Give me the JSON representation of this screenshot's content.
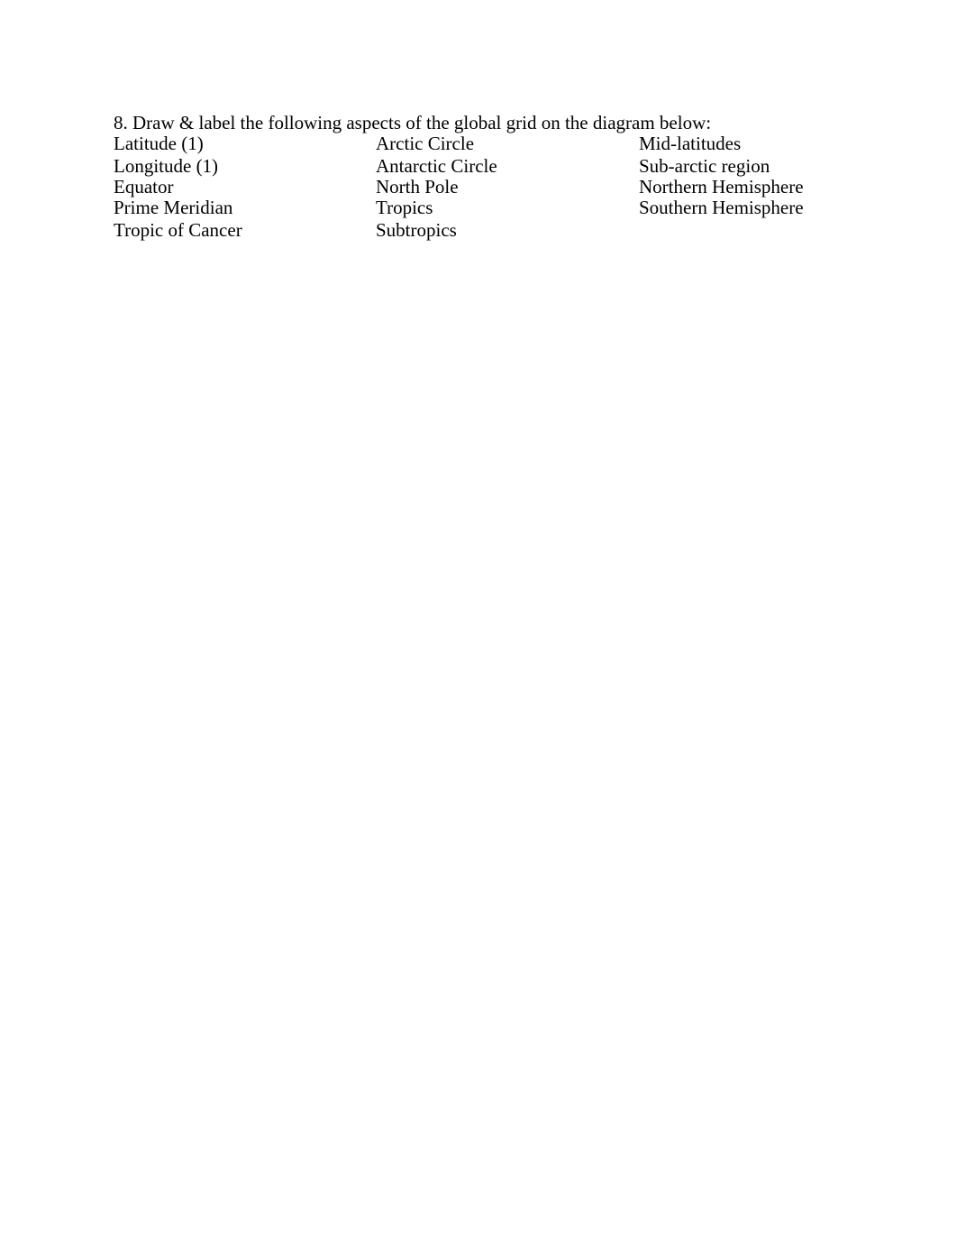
{
  "question": {
    "number": "8.",
    "text": "8. Draw & label the following aspects of the global grid on the diagram below:"
  },
  "terms": {
    "column1": [
      "Latitude (1)",
      "Longitude (1)",
      "Equator",
      "Prime Meridian",
      "Tropic of Cancer"
    ],
    "column2": [
      "Arctic Circle",
      "Antarctic Circle",
      "North Pole",
      "Tropics",
      "Subtropics"
    ],
    "column3": [
      "Mid-latitudes",
      "Sub-arctic region",
      "Northern Hemisphere",
      "Southern Hemisphere"
    ]
  }
}
